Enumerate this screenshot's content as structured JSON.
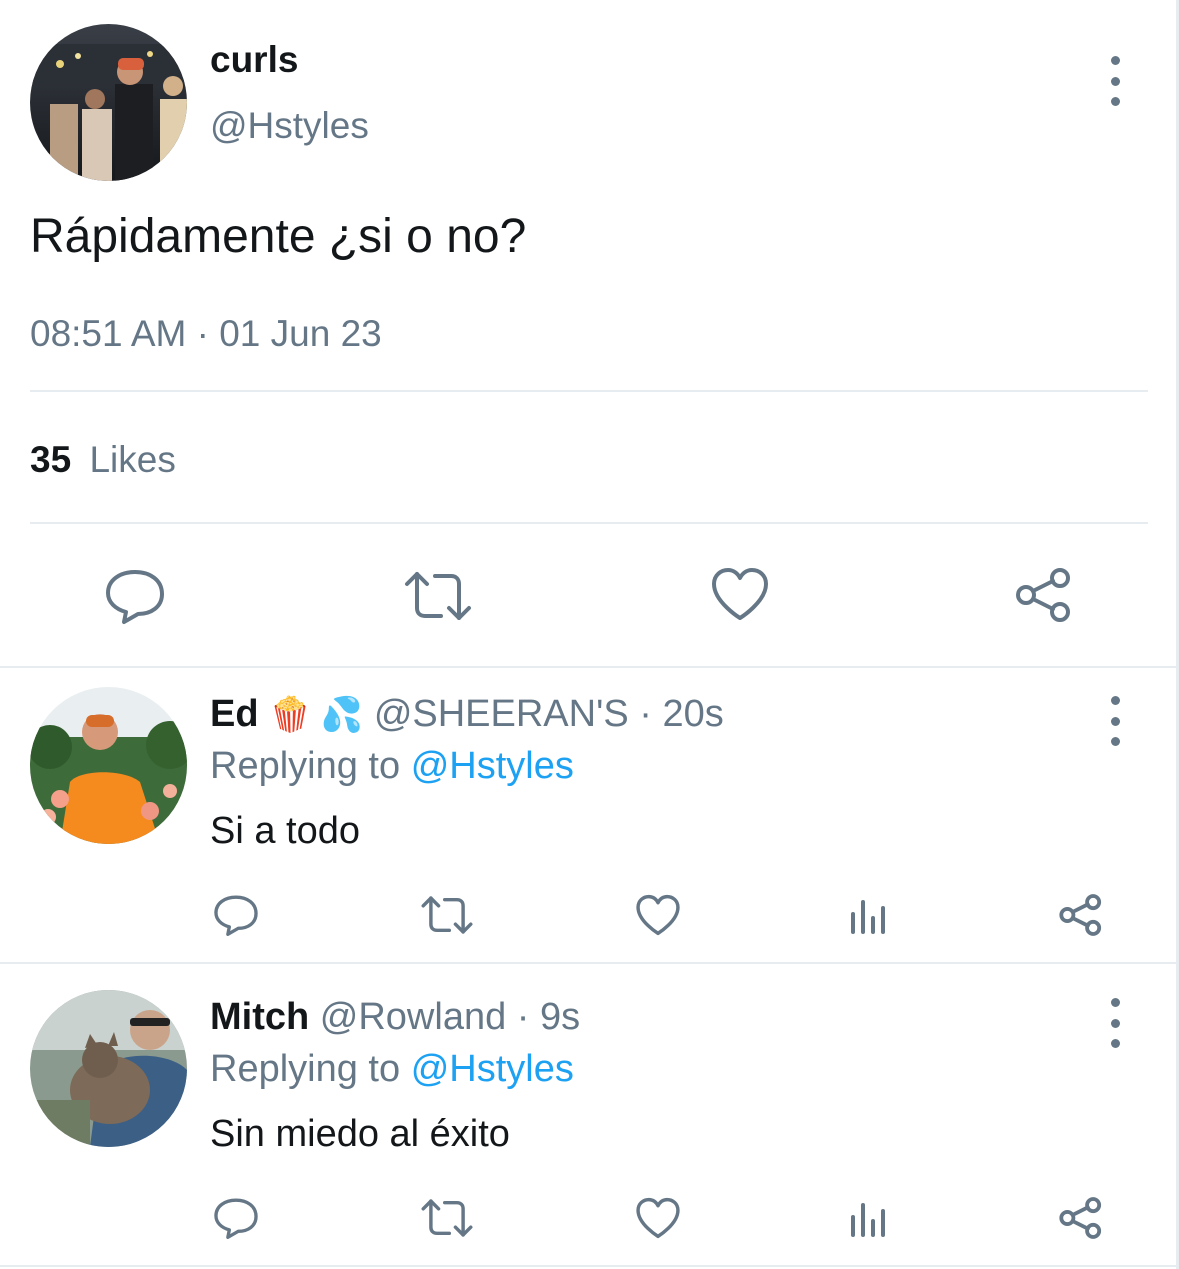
{
  "main": {
    "display_name": "curls",
    "handle": "@Hstyles",
    "text": "Rápidamente ¿si o no?",
    "timestamp": "08:51 AM · 01 Jun 23",
    "likes_count": "35",
    "likes_label": "Likes",
    "actions": [
      "reply-icon",
      "retweet-icon",
      "like-icon",
      "share-icon"
    ]
  },
  "replies": [
    {
      "name": "Ed",
      "emojis": "🍿 💦",
      "handle": "@SHEERAN'S",
      "time_sep": "·",
      "time": "20s",
      "replying_prefix": "Replying to",
      "replying_handle": "@Hstyles",
      "text": "Si a todo"
    },
    {
      "name": "Mitch",
      "handle": "@Rowland",
      "time_sep": "·",
      "time": "9s",
      "replying_prefix": "Replying to",
      "replying_handle": "@Hstyles",
      "text": "Sin miedo al éxito"
    }
  ],
  "colors": {
    "muted": "#657786",
    "link": "#1da1f2",
    "divider": "#e6ecf0"
  }
}
